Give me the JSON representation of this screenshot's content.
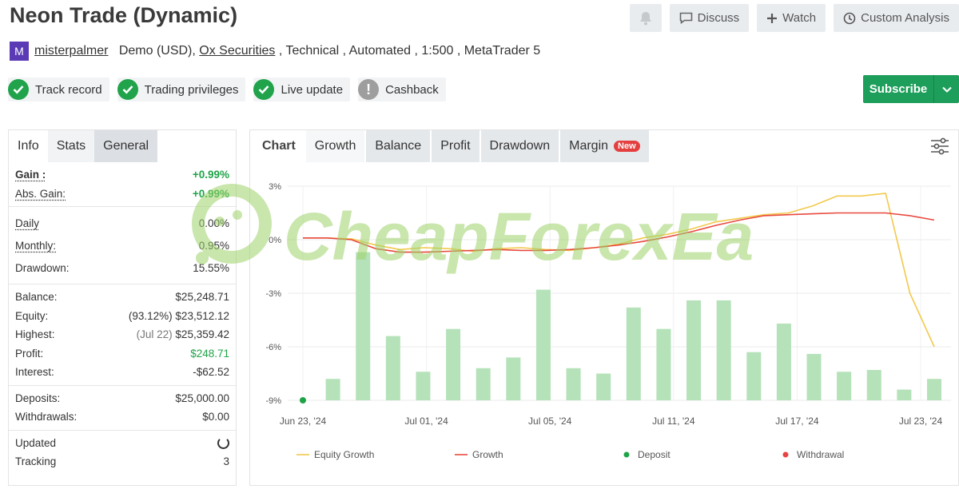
{
  "header": {
    "title": "Neon Trade (Dynamic)",
    "actions": {
      "discuss": "Discuss",
      "watch": "Watch",
      "custom_analysis": "Custom Analysis"
    }
  },
  "account": {
    "avatar_letter": "M",
    "username": "misterpalmer",
    "type": "Demo (USD),",
    "broker": "Ox Securities",
    "details": " , Technical , Automated , 1:500 , MetaTrader 5"
  },
  "badges": [
    {
      "label": "Track record",
      "status": "ok"
    },
    {
      "label": "Trading privileges",
      "status": "ok"
    },
    {
      "label": "Live update",
      "status": "ok"
    },
    {
      "label": "Cashback",
      "status": "warn"
    }
  ],
  "subscribe_label": "Subscribe",
  "info_tabs": [
    "Info",
    "Stats",
    "General"
  ],
  "stats": {
    "gain": {
      "label": "Gain :",
      "value": "+0.99%"
    },
    "abs_gain": {
      "label": "Abs. Gain:",
      "value": "+0.99%"
    },
    "daily": {
      "label": "Daily",
      "value": "0.00%"
    },
    "monthly": {
      "label": "Monthly:",
      "value": "0.95%"
    },
    "drawdown": {
      "label": "Drawdown:",
      "value": "15.55%"
    },
    "balance": {
      "label": "Balance:",
      "value": "$25,248.71"
    },
    "equity": {
      "label": "Equity:",
      "prefix": "(93.12%)",
      "value": "$23,512.12"
    },
    "highest": {
      "label": "Highest:",
      "prefix": "(Jul 22)",
      "value": "$25,359.42"
    },
    "profit": {
      "label": "Profit:",
      "value": "$248.71"
    },
    "interest": {
      "label": "Interest:",
      "value": "-$62.52"
    },
    "deposits": {
      "label": "Deposits:",
      "value": "$25,000.00"
    },
    "withdrawals": {
      "label": "Withdrawals:",
      "value": "$0.00"
    },
    "updated": {
      "label": "Updated"
    },
    "tracking": {
      "label": "Tracking",
      "value": "3"
    }
  },
  "chart_tabs": {
    "title": "Chart",
    "items": [
      "Growth",
      "Balance",
      "Profit",
      "Drawdown",
      "Margin"
    ],
    "new_tag": "New"
  },
  "watermark": "CheapForexEa",
  "colors": {
    "equity": "#f2c94c",
    "growth": "#e8493f",
    "deposit": "#1fa347",
    "withdrawal": "#e84343",
    "bars": "#b5e2b9"
  },
  "chart_data": {
    "type": "line",
    "ylim": [
      -9,
      3
    ],
    "yticks": [
      "3%",
      "0%",
      "-3%",
      "-6%",
      "-9%"
    ],
    "xticks": [
      "Jun 23, '24",
      "Jul 01, '24",
      "Jul 05, '24",
      "Jul 11, '24",
      "Jul 17, '24",
      "Jul 23, '24"
    ],
    "series": [
      {
        "name": "Equity Growth",
        "values": [
          0.1,
          0.1,
          0.05,
          -0.3,
          -0.55,
          -0.45,
          -0.5,
          -0.65,
          -0.5,
          -0.45,
          -0.55,
          -0.6,
          -0.45,
          -0.25,
          0.1,
          0.3,
          0.6,
          1.0,
          1.2,
          1.4,
          1.5,
          1.9,
          2.45,
          2.45,
          2.6,
          -3.0,
          -6.0
        ]
      },
      {
        "name": "Growth",
        "values": [
          0.1,
          0.1,
          0.0,
          -0.5,
          -0.7,
          -0.7,
          -0.65,
          -0.6,
          -0.55,
          -0.6,
          -0.6,
          -0.55,
          -0.45,
          -0.3,
          -0.1,
          0.15,
          0.45,
          0.8,
          1.1,
          1.35,
          1.4,
          1.45,
          1.5,
          1.5,
          1.5,
          1.35,
          1.1
        ]
      }
    ],
    "bars": [
      0,
      1.2,
      8.3,
      3.6,
      1.6,
      4.0,
      1.8,
      2.4,
      6.2,
      1.8,
      1.5,
      5.2,
      4.0,
      5.6,
      5.6,
      2.7,
      4.3,
      2.6,
      1.6,
      1.7,
      0.6,
      1.2
    ],
    "markers": [
      {
        "type": "Deposit",
        "x": 0,
        "y": -9
      }
    ],
    "legend": [
      "Equity Growth",
      "Growth",
      "Deposit",
      "Withdrawal"
    ]
  }
}
